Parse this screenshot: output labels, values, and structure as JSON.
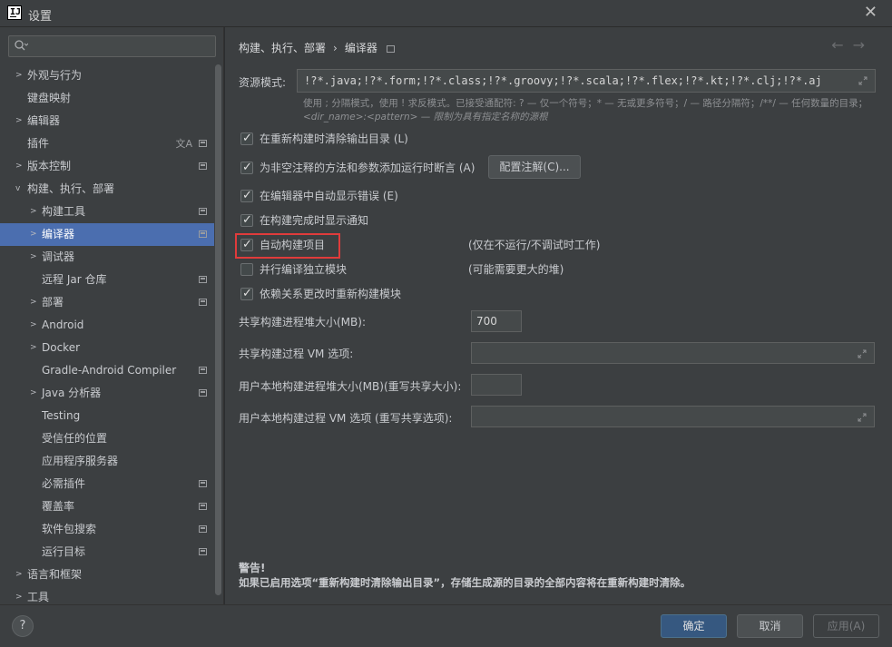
{
  "window": {
    "title": "设置",
    "app_icon_text": "IJ"
  },
  "sidebar": {
    "search_placeholder": "",
    "items": [
      {
        "label": "外观与行为",
        "has_arrow": true,
        "arrow": ">",
        "indent": 0
      },
      {
        "label": "键盘映射",
        "has_arrow": false,
        "indent": 0
      },
      {
        "label": "编辑器",
        "has_arrow": true,
        "arrow": ">",
        "indent": 0
      },
      {
        "label": "插件",
        "has_arrow": false,
        "indent": 0,
        "lang_icon": "文A",
        "pin": true
      },
      {
        "label": "版本控制",
        "has_arrow": true,
        "arrow": ">",
        "indent": 0,
        "pin": true
      },
      {
        "label": "构建、执行、部署",
        "has_arrow": true,
        "arrow": "v",
        "indent": 0
      },
      {
        "label": "构建工具",
        "has_arrow": true,
        "arrow": ">",
        "indent": 1,
        "pin": true
      },
      {
        "label": "编译器",
        "has_arrow": true,
        "arrow": ">",
        "indent": 1,
        "pin": true,
        "selected": true
      },
      {
        "label": "调试器",
        "has_arrow": true,
        "arrow": ">",
        "indent": 1
      },
      {
        "label": "远程 Jar 仓库",
        "has_arrow": false,
        "indent": 1,
        "pin": true
      },
      {
        "label": "部署",
        "has_arrow": true,
        "arrow": ">",
        "indent": 1,
        "pin": true
      },
      {
        "label": "Android",
        "has_arrow": true,
        "arrow": ">",
        "indent": 1
      },
      {
        "label": "Docker",
        "has_arrow": true,
        "arrow": ">",
        "indent": 1
      },
      {
        "label": "Gradle-Android Compiler",
        "has_arrow": false,
        "indent": 1,
        "pin": true
      },
      {
        "label": "Java 分析器",
        "has_arrow": true,
        "arrow": ">",
        "indent": 1,
        "pin": true
      },
      {
        "label": "Testing",
        "has_arrow": false,
        "indent": 1
      },
      {
        "label": "受信任的位置",
        "has_arrow": false,
        "indent": 1
      },
      {
        "label": "应用程序服务器",
        "has_arrow": false,
        "indent": 1
      },
      {
        "label": "必需插件",
        "has_arrow": false,
        "indent": 1,
        "pin": true
      },
      {
        "label": "覆盖率",
        "has_arrow": false,
        "indent": 1,
        "pin": true
      },
      {
        "label": "软件包搜索",
        "has_arrow": false,
        "indent": 1,
        "pin": true
      },
      {
        "label": "运行目标",
        "has_arrow": false,
        "indent": 1,
        "pin": true
      },
      {
        "label": "语言和框架",
        "has_arrow": true,
        "arrow": ">",
        "indent": 0
      },
      {
        "label": "工具",
        "has_arrow": true,
        "arrow": ">",
        "indent": 0
      }
    ]
  },
  "main": {
    "breadcrumb": {
      "parent": "构建、执行、部署",
      "separator": "›",
      "current": "编译器"
    },
    "nav": {
      "back": "←",
      "forward": "→"
    },
    "resource": {
      "label": "资源模式:",
      "value": "!?*.java;!?*.form;!?*.class;!?*.groovy;!?*.scala;!?*.flex;!?*.kt;!?*.clj;!?*.aj",
      "hint_line1": "使用 ; 分隔模式，使用 ! 求反模式。已接受通配符: ? — 仅一个符号；* — 无或更多符号；/ — 路径分隔符；/**/ — 任何数量的目录；",
      "hint_line2": "<dir_name>:<pattern> — 限制为具有指定名称的源根"
    },
    "checkboxes": [
      {
        "label": "在重新构建时清除输出目录 (L)",
        "checked": true
      },
      {
        "label": "为非空注释的方法和参数添加运行时断言 (A)",
        "checked": true
      },
      {
        "label": "在编辑器中自动显示错误 (E)",
        "checked": true
      },
      {
        "label": "在构建完成时显示通知",
        "checked": true
      },
      {
        "label": "自动构建项目",
        "checked": true,
        "note": "(仅在不运行/不调试时工作)"
      },
      {
        "label": "并行编译独立模块",
        "checked": false,
        "note": "(可能需要更大的堆)"
      },
      {
        "label": "依赖关系更改时重新构建模块",
        "checked": true
      }
    ],
    "config_button": "配置注解(C)...",
    "fields": {
      "shared_heap_label": "共享构建进程堆大小(MB):",
      "shared_heap_value": "700",
      "shared_vm_label": "共享构建过程 VM 选项:",
      "shared_vm_value": "",
      "local_heap_label": "用户本地构建进程堆大小(MB)(重写共享大小):",
      "local_heap_value": "",
      "local_vm_label": "用户本地构建过程 VM 选项 (重写共享选项):",
      "local_vm_value": ""
    },
    "warning": {
      "title": "警告!",
      "text": "如果已启用选项“重新构建时清除输出目录”，存储生成源的目录的全部内容将在重新构建时清除。"
    }
  },
  "footer": {
    "help": "?",
    "ok": "确定",
    "cancel": "取消",
    "apply": "应用(A)"
  },
  "colors": {
    "accent_selected": "#4b6eaf",
    "primary_button": "#365880",
    "highlight_box": "#e03b3b"
  }
}
